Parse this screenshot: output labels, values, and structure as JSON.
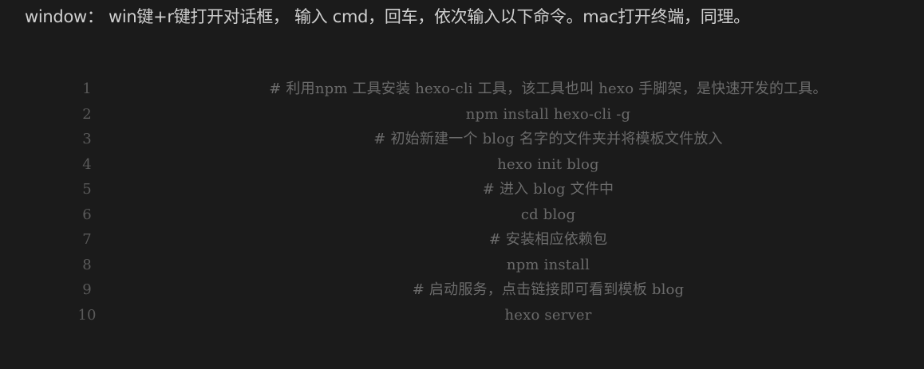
{
  "intro": {
    "text": "window： win键+r键打开对话框， 输入 cmd，回车，依次输入以下命令。mac打开终端，同理。"
  },
  "code": {
    "lines": [
      {
        "number": "1",
        "text": "# 利用npm 工具安装 hexo-cli 工具，该工具也叫 hexo 手脚架，是快速开发的工具。"
      },
      {
        "number": "2",
        "text": "npm install hexo-cli -g"
      },
      {
        "number": "3",
        "text": "# 初始新建一个 blog 名字的文件夹并将模板文件放入"
      },
      {
        "number": "4",
        "text": "hexo init blog"
      },
      {
        "number": "5",
        "text": "# 进入 blog 文件中"
      },
      {
        "number": "6",
        "text": "cd blog"
      },
      {
        "number": "7",
        "text": "# 安装相应依赖包"
      },
      {
        "number": "8",
        "text": "npm install"
      },
      {
        "number": "9",
        "text": "# 启动服务，点击链接即可看到模板 blog"
      },
      {
        "number": "10",
        "text": "hexo server"
      }
    ]
  }
}
